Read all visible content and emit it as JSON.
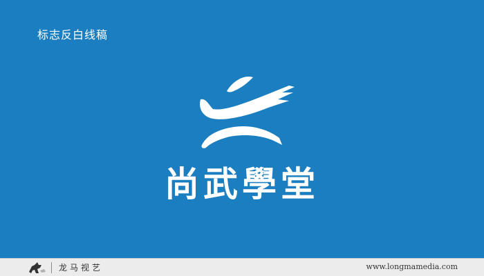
{
  "header": {
    "title": "标志反白线稿"
  },
  "logo": {
    "emblem_icon": "brush-stroke-emblem-icon",
    "wordmark": "尚武學堂"
  },
  "footer": {
    "logo_icon": "running-horse-logo-icon",
    "brand": "龙马视艺",
    "url": "www.longmamedia.com"
  },
  "colors": {
    "background": "#1a7ec0",
    "logo": "#ffffff",
    "footer_bg": "#ececec",
    "footer_text": "#333333"
  }
}
